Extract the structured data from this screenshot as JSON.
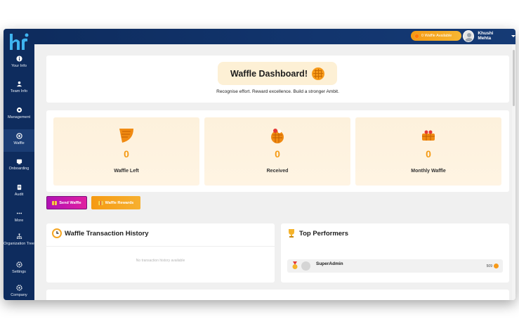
{
  "sidebar": {
    "items": [
      {
        "label": "Your Info",
        "icon": "info-icon"
      },
      {
        "label": "Team Info",
        "icon": "team-icon"
      },
      {
        "label": "Management",
        "icon": "management-icon"
      },
      {
        "label": "Waffle",
        "icon": "waffle-icon"
      },
      {
        "label": "Onboarding",
        "icon": "onboarding-icon"
      },
      {
        "label": "Audit",
        "icon": "audit-icon"
      },
      {
        "label": "More",
        "icon": "more-icon"
      },
      {
        "label": "Organization Tree",
        "icon": "org-tree-icon"
      },
      {
        "label": "Settings",
        "icon": "gear-icon"
      },
      {
        "label": "Company",
        "icon": "company-icon"
      }
    ],
    "active": "Waffle"
  },
  "topbar": {
    "waffle_pill": "0 Waffle Available",
    "user_name": "Khushi Mehta"
  },
  "hero": {
    "title": "Waffle Dashboard!",
    "subtitle": "Recognise effort. Reward excellence. Build a stronger Ambit."
  },
  "stats": [
    {
      "value": "0",
      "label": "Waffle Left"
    },
    {
      "value": "0",
      "label": "Received"
    },
    {
      "value": "0",
      "label": "Monthly Waffle"
    }
  ],
  "actions": {
    "send": "Send Waffle",
    "rewards": "Waffle Rewards"
  },
  "history": {
    "title": "Waffle Transaction History",
    "empty": "No transaction history available"
  },
  "performers": {
    "title": "Top Performers",
    "rows": [
      {
        "name": "SuperAdmin",
        "score": "509"
      }
    ]
  },
  "colors": {
    "sidebar": "#0e2c5e",
    "accent": "#f59a13",
    "send_button": "#c018aa"
  }
}
